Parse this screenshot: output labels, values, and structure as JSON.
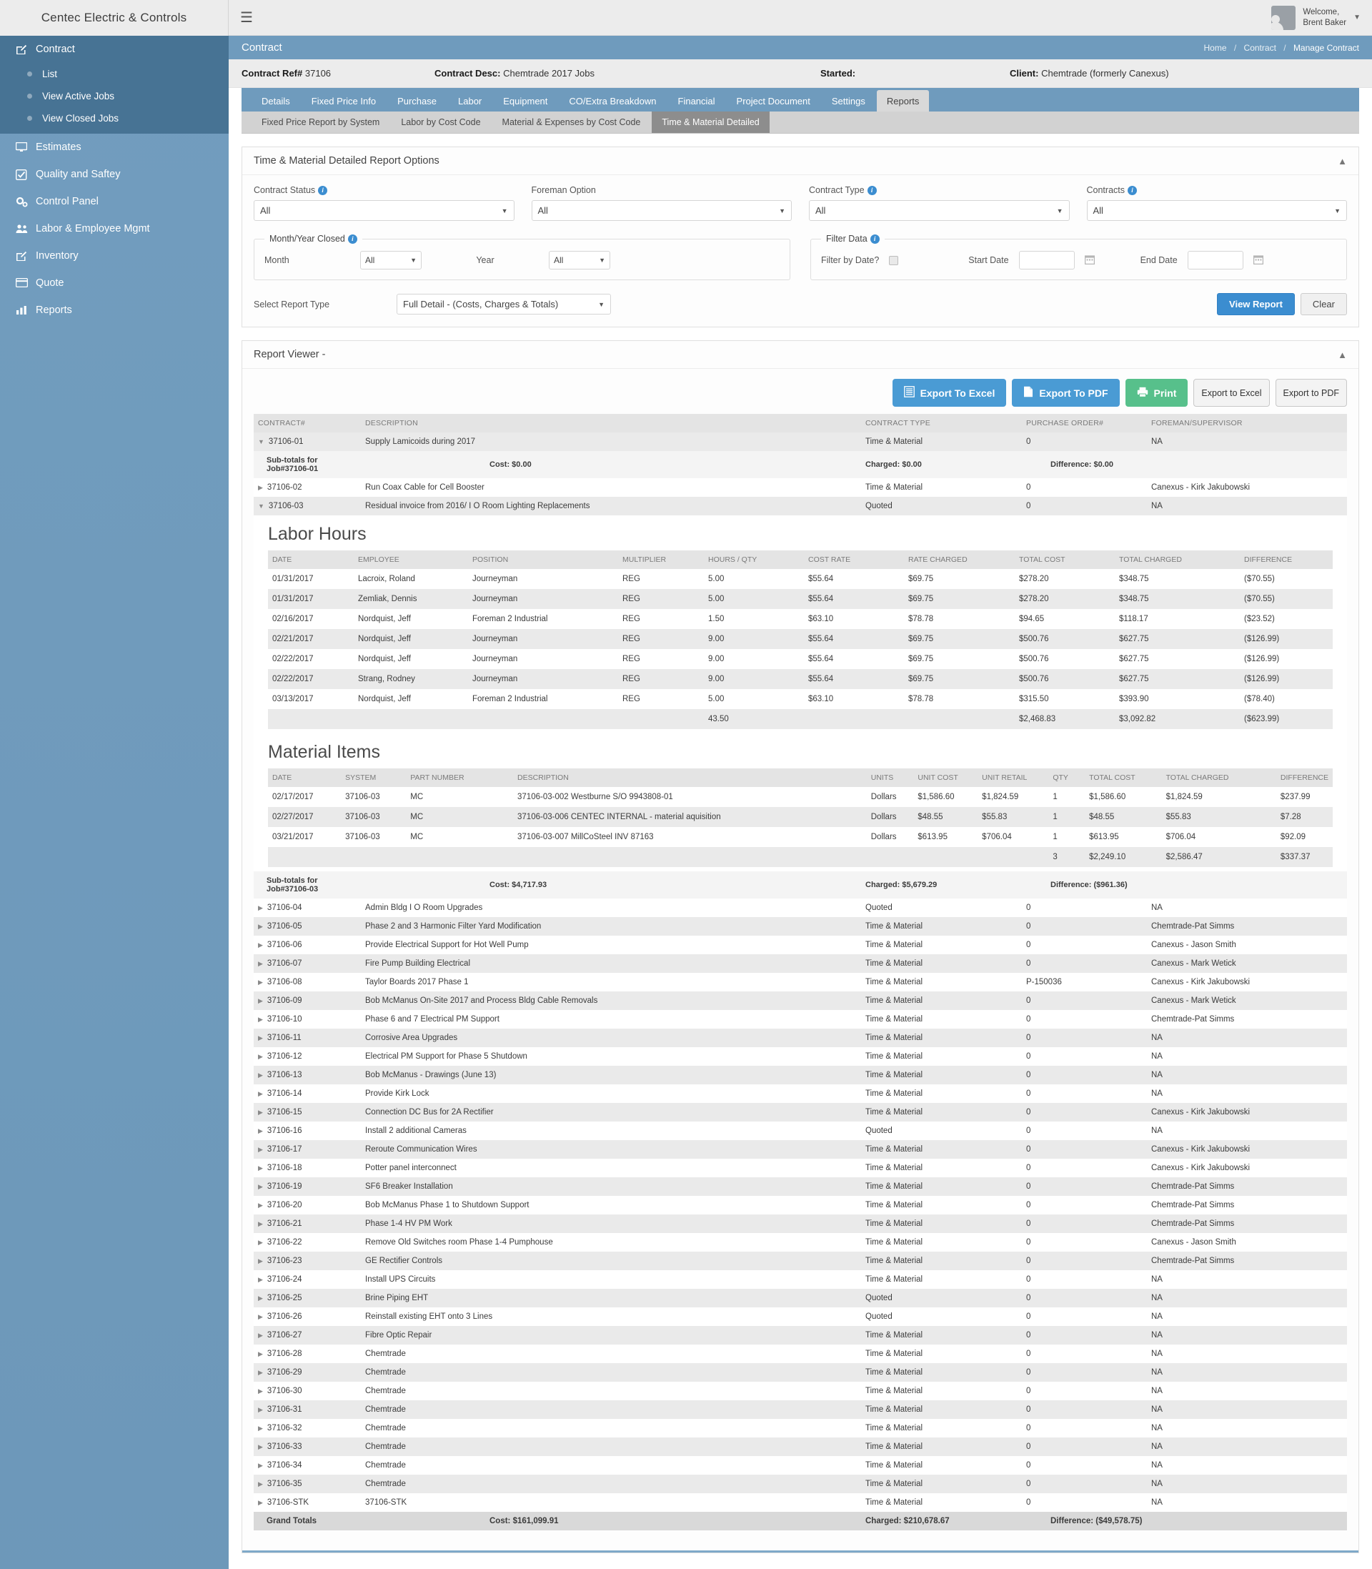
{
  "brand": "Centec Electric & Controls",
  "header": {
    "hamburger_icon": "hamburger-icon",
    "welcome_line1": "Welcome,",
    "welcome_line2": "Brent Baker"
  },
  "sidebar": {
    "items": [
      {
        "label": "Contract",
        "icon": "edit-icon",
        "active": true
      },
      {
        "label": "Estimates",
        "icon": "monitor-icon"
      },
      {
        "label": "Quality and Saftey",
        "icon": "check-square-icon"
      },
      {
        "label": "Control Panel",
        "icon": "gears-icon"
      },
      {
        "label": "Labor & Employee Mgmt",
        "icon": "users-icon"
      },
      {
        "label": "Inventory",
        "icon": "edit-icon"
      },
      {
        "label": "Quote",
        "icon": "card-icon"
      },
      {
        "label": "Reports",
        "icon": "chart-icon"
      }
    ],
    "subitems": [
      {
        "label": "List"
      },
      {
        "label": "View Active Jobs"
      },
      {
        "label": "View Closed Jobs"
      }
    ]
  },
  "page": {
    "title": "Contract",
    "breadcrumb": [
      "Home",
      "Contract",
      "Manage Contract"
    ]
  },
  "info_strip": {
    "ref_label": "Contract Ref#",
    "ref_value": "37106",
    "desc_label": "Contract Desc:",
    "desc_value": "Chemtrade 2017 Jobs",
    "started_label": "Started:",
    "started_value": "",
    "client_label": "Client:",
    "client_value": "Chemtrade (formerly Canexus)"
  },
  "tabs": [
    {
      "label": "Details"
    },
    {
      "label": "Fixed Price Info"
    },
    {
      "label": "Purchase"
    },
    {
      "label": "Labor"
    },
    {
      "label": "Equipment"
    },
    {
      "label": "CO/Extra Breakdown"
    },
    {
      "label": "Financial"
    },
    {
      "label": "Project Document"
    },
    {
      "label": "Settings"
    },
    {
      "label": "Reports",
      "active": true
    }
  ],
  "subtabs": [
    {
      "label": "Fixed Price Report by System"
    },
    {
      "label": "Labor by Cost Code"
    },
    {
      "label": "Material & Expenses by Cost Code"
    },
    {
      "label": "Time & Material Detailed",
      "active": true
    }
  ],
  "options_panel": {
    "title": "Time & Material Detailed Report Options",
    "fields": {
      "contract_status_label": "Contract Status",
      "contract_status_value": "All",
      "foreman_option_label": "Foreman Option",
      "foreman_option_value": "All",
      "contract_type_label": "Contract Type",
      "contract_type_value": "All",
      "contracts_label": "Contracts",
      "contracts_value": "All"
    },
    "month_year_fieldset": {
      "legend": "Month/Year Closed",
      "month_label": "Month",
      "month_value": "All",
      "year_label": "Year",
      "year_value": "All"
    },
    "filter_data_fieldset": {
      "legend": "Filter Data",
      "filter_by_date_label": "Filter by Date?",
      "start_date_label": "Start Date",
      "start_date_value": "",
      "end_date_label": "End Date",
      "end_date_value": ""
    },
    "report_type_label": "Select Report Type",
    "report_type_value": "Full Detail - (Costs, Charges & Totals)",
    "view_report_button": "View Report",
    "clear_button": "Clear"
  },
  "report_viewer": {
    "title": "Report Viewer -",
    "buttons": {
      "export_excel": "Export To Excel",
      "export_pdf": "Export To PDF",
      "print": "Print",
      "export_excel_plain": "Export to Excel",
      "export_pdf_plain": "Export to PDF"
    },
    "columns": [
      "CONTRACT#",
      "DESCRIPTION",
      "CONTRACT TYPE",
      "PURCHASE ORDER#",
      "FOREMAN/SUPERVISOR"
    ],
    "rows": [
      {
        "expander": "down",
        "contract": "37106-01",
        "description": "Supply Lamicoids during 2017",
        "type": "Time & Material",
        "po": "0",
        "foreman": "NA",
        "shade": "alt"
      },
      {
        "kind": "subtotal",
        "label": "Sub-totals for Job#37106-01",
        "cost": "Cost: $0.00",
        "charged": "Charged: $0.00",
        "difference": "Difference: $0.00"
      },
      {
        "expander": "right",
        "contract": "37106-02",
        "description": "Run Coax Cable for Cell Booster",
        "type": "Time & Material",
        "po": "0",
        "foreman": "Canexus - Kirk Jakubowski",
        "shade": "white"
      },
      {
        "expander": "down",
        "contract": "37106-03",
        "description": "Residual invoice from 2016/ I O Room Lighting Replacements",
        "type": "Quoted",
        "po": "0",
        "foreman": "NA",
        "shade": "alt"
      }
    ],
    "labor_section": {
      "title": "Labor Hours",
      "columns": [
        "DATE",
        "EMPLOYEE",
        "POSITION",
        "MULTIPLIER",
        "HOURS / QTY",
        "COST RATE",
        "RATE CHARGED",
        "TOTAL COST",
        "TOTAL CHARGED",
        "DIFFERENCE"
      ],
      "rows": [
        [
          "01/31/2017",
          "Lacroix, Roland",
          "Journeyman",
          "REG",
          "5.00",
          "$55.64",
          "$69.75",
          "$278.20",
          "$348.75",
          "($70.55)"
        ],
        [
          "01/31/2017",
          "Zemliak, Dennis",
          "Journeyman",
          "REG",
          "5.00",
          "$55.64",
          "$69.75",
          "$278.20",
          "$348.75",
          "($70.55)"
        ],
        [
          "02/16/2017",
          "Nordquist, Jeff",
          "Foreman 2 Industrial",
          "REG",
          "1.50",
          "$63.10",
          "$78.78",
          "$94.65",
          "$118.17",
          "($23.52)"
        ],
        [
          "02/21/2017",
          "Nordquist, Jeff",
          "Journeyman",
          "REG",
          "9.00",
          "$55.64",
          "$69.75",
          "$500.76",
          "$627.75",
          "($126.99)"
        ],
        [
          "02/22/2017",
          "Nordquist, Jeff",
          "Journeyman",
          "REG",
          "9.00",
          "$55.64",
          "$69.75",
          "$500.76",
          "$627.75",
          "($126.99)"
        ],
        [
          "02/22/2017",
          "Strang, Rodney",
          "Journeyman",
          "REG",
          "9.00",
          "$55.64",
          "$69.75",
          "$500.76",
          "$627.75",
          "($126.99)"
        ],
        [
          "03/13/2017",
          "Nordquist, Jeff",
          "Foreman 2 Industrial",
          "REG",
          "5.00",
          "$63.10",
          "$78.78",
          "$315.50",
          "$393.90",
          "($78.40)"
        ]
      ],
      "totals": [
        "",
        "",
        "",
        "",
        "43.50",
        "",
        "",
        "$2,468.83",
        "$3,092.82",
        "($623.99)"
      ]
    },
    "material_section": {
      "title": "Material Items",
      "columns": [
        "DATE",
        "SYSTEM",
        "PART NUMBER",
        "DESCRIPTION",
        "UNITS",
        "UNIT COST",
        "UNIT RETAIL",
        "QTY",
        "TOTAL COST",
        "TOTAL CHARGED",
        "DIFFERENCE"
      ],
      "rows": [
        [
          "02/17/2017",
          "37106-03",
          "MC",
          "37106-03-002 Westburne S/O 9943808-01",
          "Dollars",
          "$1,586.60",
          "$1,824.59",
          "1",
          "$1,586.60",
          "$1,824.59",
          "$237.99"
        ],
        [
          "02/27/2017",
          "37106-03",
          "MC",
          "37106-03-006 CENTEC INTERNAL - material aquisition",
          "Dollars",
          "$48.55",
          "$55.83",
          "1",
          "$48.55",
          "$55.83",
          "$7.28"
        ],
        [
          "03/21/2017",
          "37106-03",
          "MC",
          "37106-03-007 MillCoSteel INV 87163",
          "Dollars",
          "$613.95",
          "$706.04",
          "1",
          "$613.95",
          "$706.04",
          "$92.09"
        ]
      ],
      "totals": [
        "",
        "",
        "",
        "",
        "",
        "",
        "",
        "3",
        "$2,249.10",
        "$2,586.47",
        "$337.37"
      ]
    },
    "subtotal_03": {
      "label": "Sub-totals for Job#37106-03",
      "cost": "Cost: $4,717.93",
      "charged": "Charged: $5,679.29",
      "difference": "Difference: ($961.36)"
    },
    "rows_after": [
      {
        "contract": "37106-04",
        "description": "Admin Bldg I O Room Upgrades",
        "type": "Quoted",
        "po": "0",
        "foreman": "NA"
      },
      {
        "contract": "37106-05",
        "description": "Phase 2 and 3 Harmonic Filter Yard Modification",
        "type": "Time & Material",
        "po": "0",
        "foreman": "Chemtrade-Pat Simms"
      },
      {
        "contract": "37106-06",
        "description": "Provide Electrical Support for Hot Well Pump",
        "type": "Time & Material",
        "po": "0",
        "foreman": "Canexus - Jason Smith"
      },
      {
        "contract": "37106-07",
        "description": "Fire Pump Building Electrical",
        "type": "Time & Material",
        "po": "0",
        "foreman": "Canexus - Mark Wetick"
      },
      {
        "contract": "37106-08",
        "description": "Taylor Boards 2017 Phase 1",
        "type": "Time & Material",
        "po": "P-150036",
        "foreman": "Canexus - Kirk Jakubowski"
      },
      {
        "contract": "37106-09",
        "description": "Bob McManus On-Site 2017 and Process Bldg Cable Removals",
        "type": "Time & Material",
        "po": "0",
        "foreman": "Canexus - Mark Wetick"
      },
      {
        "contract": "37106-10",
        "description": "Phase 6 and 7 Electrical PM Support",
        "type": "Time & Material",
        "po": "0",
        "foreman": "Chemtrade-Pat Simms"
      },
      {
        "contract": "37106-11",
        "description": "Corrosive Area Upgrades",
        "type": "Time & Material",
        "po": "0",
        "foreman": "NA"
      },
      {
        "contract": "37106-12",
        "description": "Electrical PM Support for Phase 5 Shutdown",
        "type": "Time & Material",
        "po": "0",
        "foreman": "NA"
      },
      {
        "contract": "37106-13",
        "description": "Bob McManus - Drawings (June 13)",
        "type": "Time & Material",
        "po": "0",
        "foreman": "NA"
      },
      {
        "contract": "37106-14",
        "description": "Provide Kirk Lock",
        "type": "Time & Material",
        "po": "0",
        "foreman": "NA"
      },
      {
        "contract": "37106-15",
        "description": "Connection DC Bus for 2A Rectifier",
        "type": "Time & Material",
        "po": "0",
        "foreman": "Canexus - Kirk Jakubowski"
      },
      {
        "contract": "37106-16",
        "description": "Install 2 additional Cameras",
        "type": "Quoted",
        "po": "0",
        "foreman": "NA"
      },
      {
        "contract": "37106-17",
        "description": "Reroute Communication Wires",
        "type": "Time & Material",
        "po": "0",
        "foreman": "Canexus - Kirk Jakubowski"
      },
      {
        "contract": "37106-18",
        "description": "Potter panel interconnect",
        "type": "Time & Material",
        "po": "0",
        "foreman": "Canexus - Kirk Jakubowski"
      },
      {
        "contract": "37106-19",
        "description": "SF6 Breaker Installation",
        "type": "Time & Material",
        "po": "0",
        "foreman": "Chemtrade-Pat Simms"
      },
      {
        "contract": "37106-20",
        "description": "Bob McManus Phase 1 to Shutdown Support",
        "type": "Time & Material",
        "po": "0",
        "foreman": "Chemtrade-Pat Simms"
      },
      {
        "contract": "37106-21",
        "description": "Phase 1-4 HV PM Work",
        "type": "Time & Material",
        "po": "0",
        "foreman": "Chemtrade-Pat Simms"
      },
      {
        "contract": "37106-22",
        "description": "Remove Old Switches room Phase 1-4 Pumphouse",
        "type": "Time & Material",
        "po": "0",
        "foreman": "Canexus - Jason Smith"
      },
      {
        "contract": "37106-23",
        "description": "GE Rectifier Controls",
        "type": "Time & Material",
        "po": "0",
        "foreman": "Chemtrade-Pat Simms"
      },
      {
        "contract": "37106-24",
        "description": "Install UPS Circuits",
        "type": "Time & Material",
        "po": "0",
        "foreman": "NA"
      },
      {
        "contract": "37106-25",
        "description": "Brine Piping EHT",
        "type": "Quoted",
        "po": "0",
        "foreman": "NA"
      },
      {
        "contract": "37106-26",
        "description": "Reinstall existing EHT onto 3 Lines",
        "type": "Quoted",
        "po": "0",
        "foreman": "NA"
      },
      {
        "contract": "37106-27",
        "description": "Fibre Optic Repair",
        "type": "Time & Material",
        "po": "0",
        "foreman": "NA"
      },
      {
        "contract": "37106-28",
        "description": "Chemtrade",
        "type": "Time & Material",
        "po": "0",
        "foreman": "NA"
      },
      {
        "contract": "37106-29",
        "description": "Chemtrade",
        "type": "Time & Material",
        "po": "0",
        "foreman": "NA"
      },
      {
        "contract": "37106-30",
        "description": "Chemtrade",
        "type": "Time & Material",
        "po": "0",
        "foreman": "NA"
      },
      {
        "contract": "37106-31",
        "description": "Chemtrade",
        "type": "Time & Material",
        "po": "0",
        "foreman": "NA"
      },
      {
        "contract": "37106-32",
        "description": "Chemtrade",
        "type": "Time & Material",
        "po": "0",
        "foreman": "NA"
      },
      {
        "contract": "37106-33",
        "description": "Chemtrade",
        "type": "Time & Material",
        "po": "0",
        "foreman": "NA"
      },
      {
        "contract": "37106-34",
        "description": "Chemtrade",
        "type": "Time & Material",
        "po": "0",
        "foreman": "NA"
      },
      {
        "contract": "37106-35",
        "description": "Chemtrade",
        "type": "Time & Material",
        "po": "0",
        "foreman": "NA"
      },
      {
        "contract": "37106-STK",
        "description": "37106-STK",
        "type": "Time & Material",
        "po": "0",
        "foreman": "NA"
      }
    ],
    "grand_totals": {
      "label": "Grand Totals",
      "cost": "Cost: $161,099.91",
      "charged": "Charged: $210,678.67",
      "difference": "Difference: ($49,578.75)"
    }
  },
  "colors": {
    "sidebar": "#6f9bbd",
    "sidebar_active": "#477394",
    "accent": "#3b8dd0",
    "green": "#57c08b"
  }
}
